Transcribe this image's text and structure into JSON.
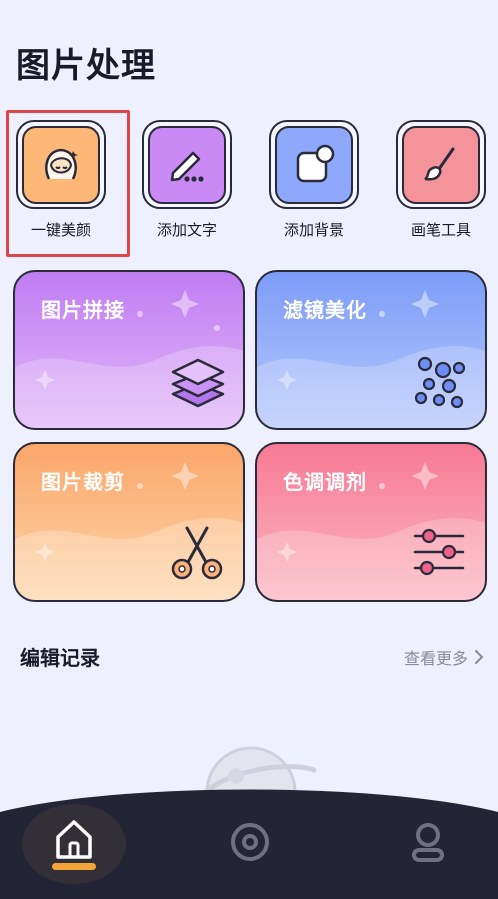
{
  "header": {
    "title": "图片处理"
  },
  "tools": [
    {
      "label": "一键美颜",
      "icon": "face-beauty-icon",
      "color": "#fdb878"
    },
    {
      "label": "添加文字",
      "icon": "pencil-text-icon",
      "color": "#c98af5"
    },
    {
      "label": "添加背景",
      "icon": "background-icon",
      "color": "#8ea9fb"
    },
    {
      "label": "画笔工具",
      "icon": "brush-icon",
      "color": "#f5939a"
    }
  ],
  "cards": [
    {
      "title": "图片拼接",
      "icon": "layers-icon",
      "top": "#c07cf3",
      "bottom": "#e2b9f8"
    },
    {
      "title": "滤镜美化",
      "icon": "filter-dots-icon",
      "top": "#7c9cf8",
      "bottom": "#b7c9fb"
    },
    {
      "title": "图片裁剪",
      "icon": "scissors-icon",
      "top": "#fba66a",
      "bottom": "#fdd6ab"
    },
    {
      "title": "色调调剂",
      "icon": "sliders-icon",
      "top": "#f77a93",
      "bottom": "#fbb6c3"
    }
  ],
  "records": {
    "title": "编辑记录",
    "more_label": "查看更多"
  },
  "nav": {
    "items": [
      "home-icon",
      "camera-icon",
      "profile-icon"
    ],
    "active": "home-icon"
  },
  "colors": {
    "accent": "#f6a53b",
    "nav_bg": "#232536",
    "highlight": "#e04848"
  }
}
